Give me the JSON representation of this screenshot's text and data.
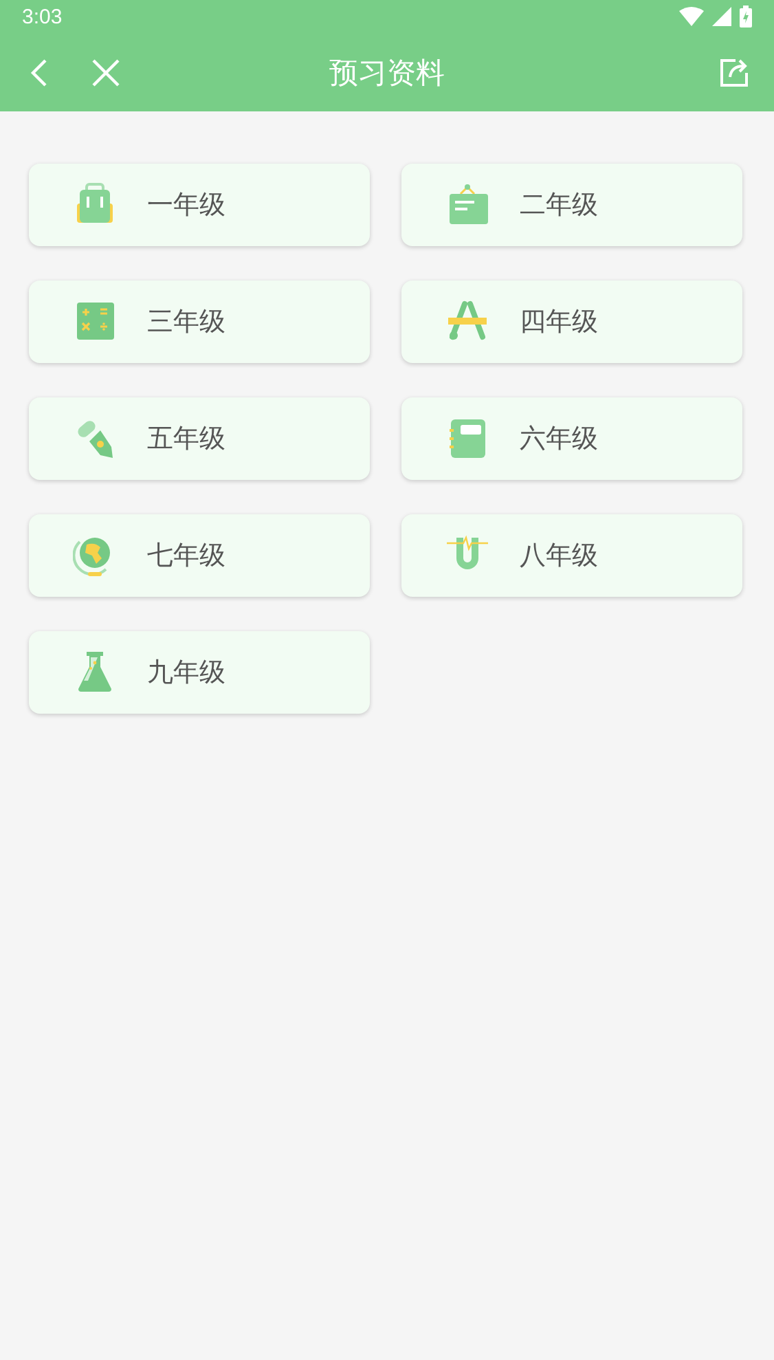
{
  "status_bar": {
    "time": "3:03"
  },
  "toolbar": {
    "title": "预习资料"
  },
  "grades": [
    {
      "label": "一年级",
      "kind": "backpack"
    },
    {
      "label": "二年级",
      "kind": "board"
    },
    {
      "label": "三年级",
      "kind": "calculator"
    },
    {
      "label": "四年级",
      "kind": "compass"
    },
    {
      "label": "五年级",
      "kind": "pen"
    },
    {
      "label": "六年级",
      "kind": "notebook"
    },
    {
      "label": "七年级",
      "kind": "globe"
    },
    {
      "label": "八年级",
      "kind": "magnet"
    },
    {
      "label": "九年级",
      "kind": "flask"
    }
  ]
}
